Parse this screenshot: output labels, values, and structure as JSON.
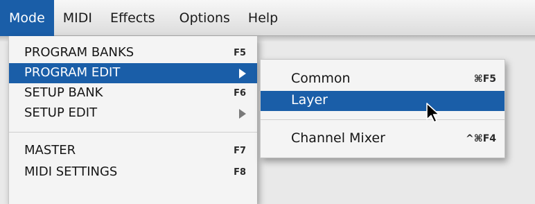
{
  "menubar": {
    "items": [
      {
        "label": "Mode",
        "active": true
      },
      {
        "label": "MIDI"
      },
      {
        "label": "Effects"
      },
      {
        "label": "Options"
      },
      {
        "label": "Help"
      }
    ]
  },
  "mode_menu": {
    "items": [
      {
        "label": "PROGRAM BANKS",
        "shortcut": "F5"
      },
      {
        "label": "PROGRAM EDIT",
        "submenu": true,
        "highlighted": true
      },
      {
        "label": "SETUP BANK",
        "shortcut": "F6"
      },
      {
        "label": "SETUP EDIT",
        "submenu": true
      },
      {
        "label": "MASTER",
        "shortcut": "F7"
      },
      {
        "label": "MIDI SETTINGS",
        "shortcut": "F8"
      }
    ]
  },
  "program_edit_submenu": {
    "items": [
      {
        "label": "Common",
        "shortcut": "⌘F5"
      },
      {
        "label": "Layer",
        "highlighted": true
      },
      {
        "label": "Channel Mixer",
        "shortcut": "^⌘F4"
      }
    ]
  },
  "colors": {
    "highlight": "#1a5ea8",
    "menu_bg": "#f4f4f4",
    "menubar_bg": "#ececec"
  },
  "cursor": {
    "icon": "arrow-pointer-icon"
  }
}
